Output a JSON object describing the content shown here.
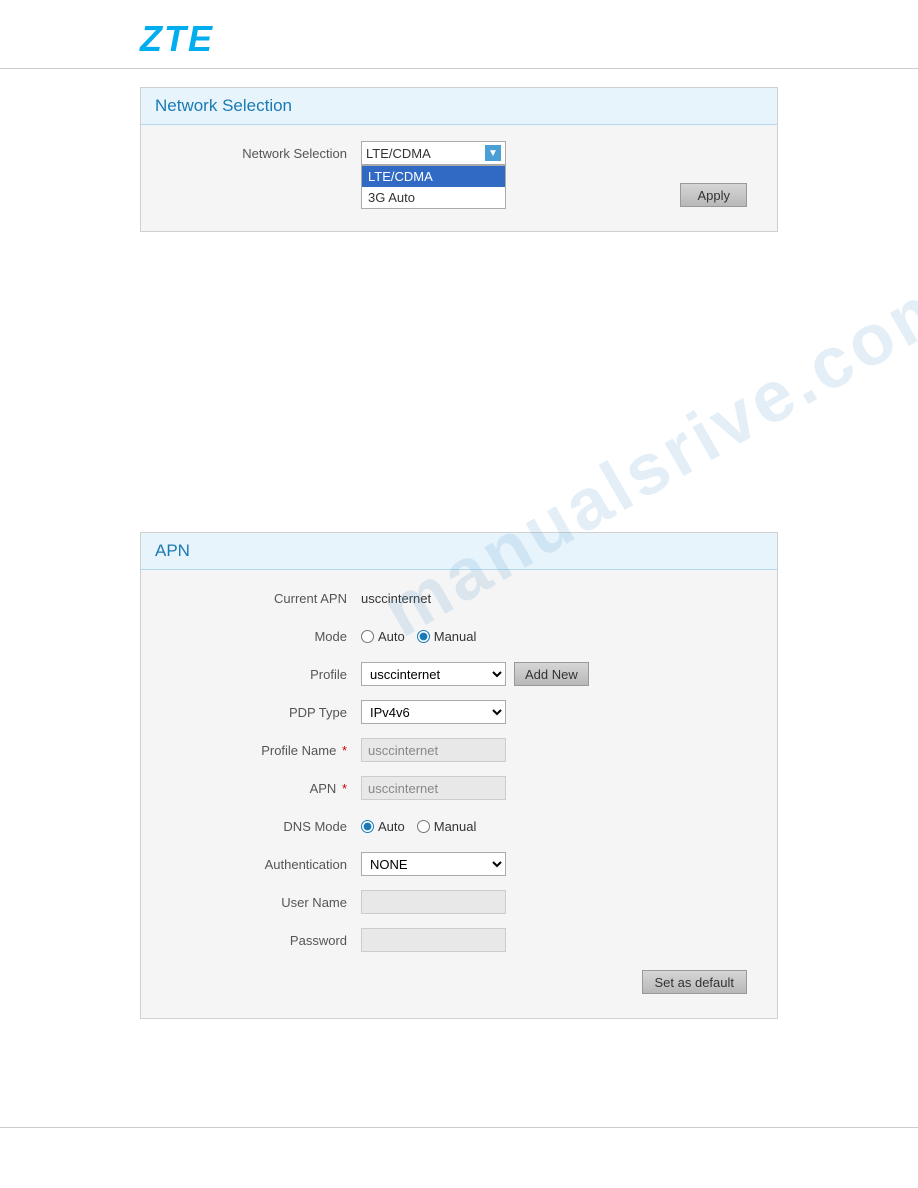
{
  "brand": {
    "logo": "ZTE"
  },
  "network_selection": {
    "section_title": "Network Selection",
    "label": "Network Selection",
    "dropdown": {
      "selected": "LTE/CDMA",
      "options": [
        "LTE/CDMA",
        "3G Auto"
      ],
      "highlighted": "LTE/CDMA"
    },
    "apply_button": "Apply"
  },
  "apn": {
    "section_title": "APN",
    "current_apn_label": "Current APN",
    "current_apn_value": "usccinternet",
    "mode_label": "Mode",
    "mode_options": [
      "Auto",
      "Manual"
    ],
    "mode_selected": "Manual",
    "profile_label": "Profile",
    "profile_options": [
      "usccinternet"
    ],
    "profile_selected": "usccinternet",
    "add_new_button": "Add New",
    "pdp_type_label": "PDP Type",
    "pdp_type_options": [
      "IPv4v6"
    ],
    "pdp_type_selected": "IPv4v6",
    "profile_name_label": "Profile Name",
    "profile_name_required": "*",
    "profile_name_value": "usccinternet",
    "apn_label": "APN",
    "apn_required": "*",
    "apn_value": "usccinternet",
    "dns_mode_label": "DNS Mode",
    "dns_mode_options": [
      "Auto",
      "Manual"
    ],
    "dns_mode_selected": "Auto",
    "authentication_label": "Authentication",
    "authentication_options": [
      "NONE"
    ],
    "authentication_selected": "NONE",
    "username_label": "User Name",
    "username_value": "",
    "password_label": "Password",
    "password_value": "",
    "set_default_button": "Set as default"
  },
  "watermark": "manualsrive.com"
}
